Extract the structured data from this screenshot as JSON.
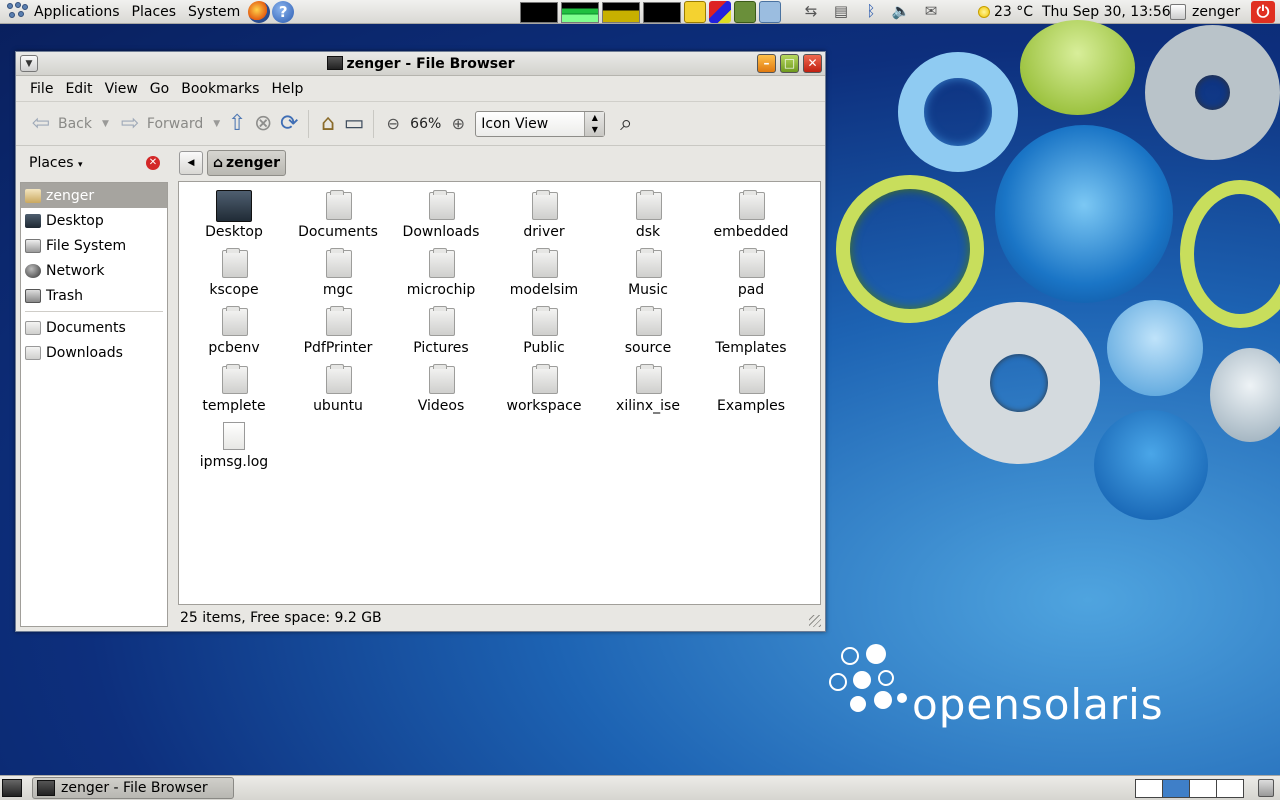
{
  "top_panel": {
    "menus": [
      "Applications",
      "Places",
      "System"
    ],
    "weather": "23 °C",
    "clock": "Thu Sep 30, 13:56",
    "user": "zenger"
  },
  "window": {
    "title": "zenger - File Browser",
    "menubar": [
      "File",
      "Edit",
      "View",
      "Go",
      "Bookmarks",
      "Help"
    ],
    "toolbar": {
      "back_label": "Back",
      "forward_label": "Forward",
      "zoom_level": "66%",
      "view_mode": "Icon View"
    },
    "sidebar": {
      "header": "Places",
      "items": [
        {
          "label": "zenger",
          "icon": "home-icon",
          "selected": true
        },
        {
          "label": "Desktop",
          "icon": "desktop-icon"
        },
        {
          "label": "File System",
          "icon": "drive-icon"
        },
        {
          "label": "Network",
          "icon": "network-icon"
        },
        {
          "label": "Trash",
          "icon": "trash-icon"
        }
      ],
      "bookmarks": [
        {
          "label": "Documents",
          "icon": "folder-icon"
        },
        {
          "label": "Downloads",
          "icon": "folder-icon"
        }
      ]
    },
    "pathbar": {
      "current": "zenger"
    },
    "files": [
      {
        "name": "Desktop",
        "type": "desktop"
      },
      {
        "name": "Documents",
        "type": "folder"
      },
      {
        "name": "Downloads",
        "type": "folder"
      },
      {
        "name": "driver",
        "type": "folder"
      },
      {
        "name": "dsk",
        "type": "folder"
      },
      {
        "name": "embedded",
        "type": "folder"
      },
      {
        "name": "kscope",
        "type": "folder"
      },
      {
        "name": "mgc",
        "type": "folder"
      },
      {
        "name": "microchip",
        "type": "folder"
      },
      {
        "name": "modelsim",
        "type": "folder"
      },
      {
        "name": "Music",
        "type": "folder"
      },
      {
        "name": "pad",
        "type": "folder"
      },
      {
        "name": "pcbenv",
        "type": "folder"
      },
      {
        "name": "PdfPrinter",
        "type": "folder"
      },
      {
        "name": "Pictures",
        "type": "folder"
      },
      {
        "name": "Public",
        "type": "folder"
      },
      {
        "name": "source",
        "type": "folder"
      },
      {
        "name": "Templates",
        "type": "folder"
      },
      {
        "name": "templete",
        "type": "folder"
      },
      {
        "name": "ubuntu",
        "type": "folder"
      },
      {
        "name": "Videos",
        "type": "folder"
      },
      {
        "name": "workspace",
        "type": "folder"
      },
      {
        "name": "xilinx_ise",
        "type": "folder"
      },
      {
        "name": "Examples",
        "type": "folder"
      },
      {
        "name": "ipmsg.log",
        "type": "file"
      }
    ],
    "status": "25 items, Free space: 9.2 GB"
  },
  "taskbar": {
    "task_label": "zenger - File Browser"
  },
  "desktop": {
    "logo_text": "opensolaris"
  },
  "colors": {
    "desktop_blue": "#0d2f7d",
    "selection": "#a6a49f",
    "close_red": "#c02010"
  }
}
